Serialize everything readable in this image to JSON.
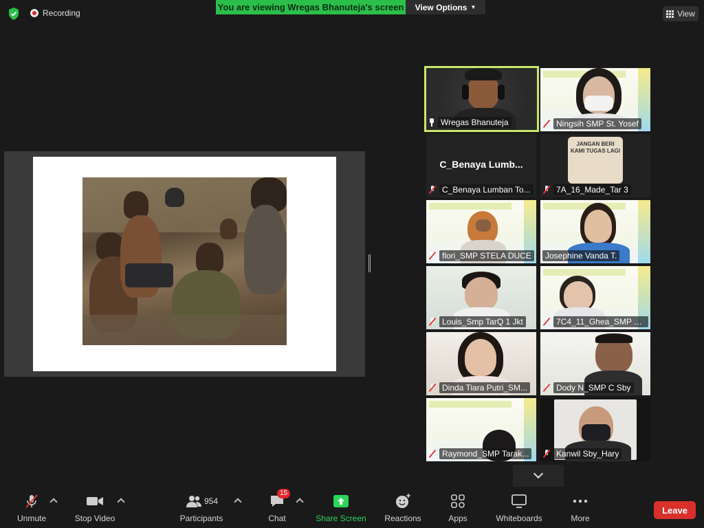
{
  "topbar": {
    "recording": "Recording",
    "viewing": "You are viewing Wregas Bhanuteja's screen",
    "view_options": "View Options",
    "view": "View"
  },
  "gallery": [
    {
      "name": "Wregas Bhanuteja",
      "muted": false,
      "active": true
    },
    {
      "name": "Ningsih SMP St. Yosef",
      "muted": true
    },
    {
      "name": "C_Benaya Lumban To...",
      "muted": true,
      "big_name": "C_Benaya  Lumb..."
    },
    {
      "name": "7A_16_Made_Tar 3",
      "muted": true,
      "image_text": "JANGAN BERI KAMI TUGAS LAGI"
    },
    {
      "name": "flori_SMP STELA DUCE",
      "muted": true
    },
    {
      "name": "Josephine Vanda T.",
      "muted": false
    },
    {
      "name": "Louis_Smp TarQ 1 Jkt",
      "muted": true
    },
    {
      "name": "7C4_11_Ghea_SMP Ta...",
      "muted": true
    },
    {
      "name": "Dinda Tiara Putri_SM...",
      "muted": true
    },
    {
      "name": "Dody N_SMP C Sby",
      "muted": true
    },
    {
      "name": "Raymond_SMP Tarak...",
      "muted": true
    },
    {
      "name": "Kanwil Sby_Hary",
      "muted": true
    }
  ],
  "toolbar": {
    "unmute": "Unmute",
    "stop_video": "Stop Video",
    "participants": "Participants",
    "participants_count": "954",
    "chat": "Chat",
    "chat_badge": "15",
    "share_screen": "Share Screen",
    "reactions": "Reactions",
    "apps": "Apps",
    "whiteboards": "Whiteboards",
    "more": "More",
    "leave": "Leave"
  },
  "colors": {
    "viewing_banner": "#2bbf4a",
    "active_speaker_border": "#c9e86a",
    "leave": "#d9302c",
    "share_icon": "#2bd55a"
  }
}
